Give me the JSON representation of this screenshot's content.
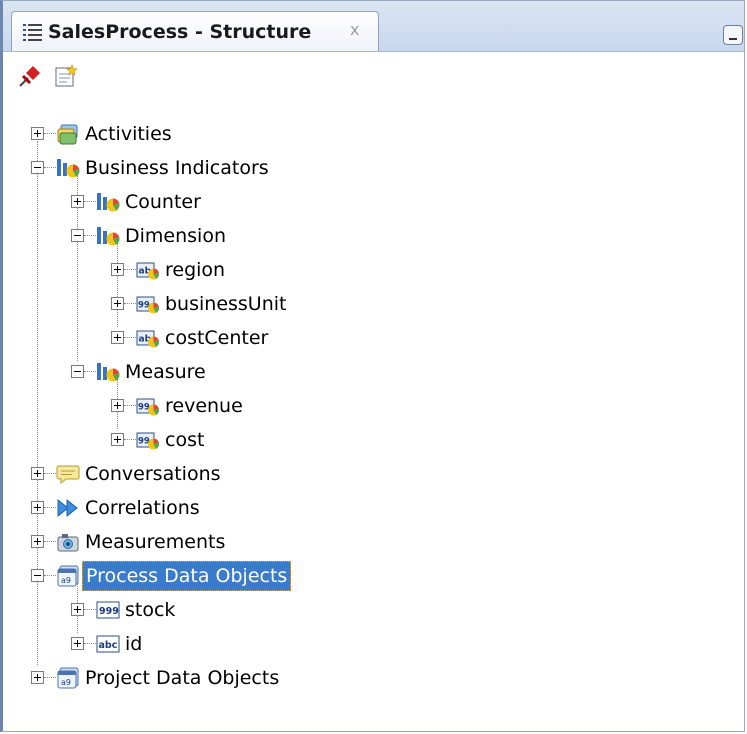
{
  "tab": {
    "title": "SalesProcess - Structure",
    "close_symbol": "x"
  },
  "toolbar": {
    "buttons": [
      {
        "icon": "pin-icon"
      },
      {
        "icon": "new-document-icon"
      }
    ]
  },
  "tree": [
    {
      "id": "activities",
      "label": "Activities",
      "level": 0,
      "expanded": false,
      "icon": "activities-icon"
    },
    {
      "id": "business-indicators",
      "label": "Business Indicators",
      "level": 0,
      "expanded": true,
      "icon": "business-indicator-icon"
    },
    {
      "id": "counter",
      "label": "Counter",
      "level": 1,
      "expanded": false,
      "icon": "business-indicator-icon"
    },
    {
      "id": "dimension",
      "label": "Dimension",
      "level": 1,
      "expanded": true,
      "icon": "business-indicator-icon"
    },
    {
      "id": "region",
      "label": "region",
      "level": 2,
      "expanded": false,
      "icon": "string-indicator-icon"
    },
    {
      "id": "businessUnit",
      "label": "businessUnit",
      "level": 2,
      "expanded": false,
      "icon": "number-indicator-icon"
    },
    {
      "id": "costCenter",
      "label": "costCenter",
      "level": 2,
      "expanded": false,
      "icon": "string-indicator-icon"
    },
    {
      "id": "measure",
      "label": "Measure",
      "level": 1,
      "expanded": true,
      "icon": "business-indicator-icon"
    },
    {
      "id": "revenue",
      "label": "revenue",
      "level": 2,
      "expanded": false,
      "icon": "number-indicator-icon"
    },
    {
      "id": "cost",
      "label": "cost",
      "level": 2,
      "expanded": false,
      "icon": "number-indicator-icon"
    },
    {
      "id": "conversations",
      "label": "Conversations",
      "level": 0,
      "expanded": false,
      "icon": "conversation-icon"
    },
    {
      "id": "correlations",
      "label": "Correlations",
      "level": 0,
      "expanded": false,
      "icon": "correlation-icon"
    },
    {
      "id": "measurements",
      "label": "Measurements",
      "level": 0,
      "expanded": false,
      "icon": "measurement-icon"
    },
    {
      "id": "process-data-objects",
      "label": "Process Data Objects",
      "level": 0,
      "expanded": true,
      "selected": true,
      "icon": "data-objects-icon"
    },
    {
      "id": "stock",
      "label": "stock",
      "level": 1,
      "expanded": false,
      "icon": "number-type-icon"
    },
    {
      "id": "id",
      "label": "id",
      "level": 1,
      "expanded": false,
      "icon": "string-type-icon"
    },
    {
      "id": "project-data-objects",
      "label": "Project Data Objects",
      "level": 0,
      "expanded": false,
      "icon": "data-objects-icon"
    }
  ],
  "colors": {
    "selection": "#3b7bcc",
    "selection_border": "#f0b030",
    "tab_bar": "#c8d7ec"
  }
}
